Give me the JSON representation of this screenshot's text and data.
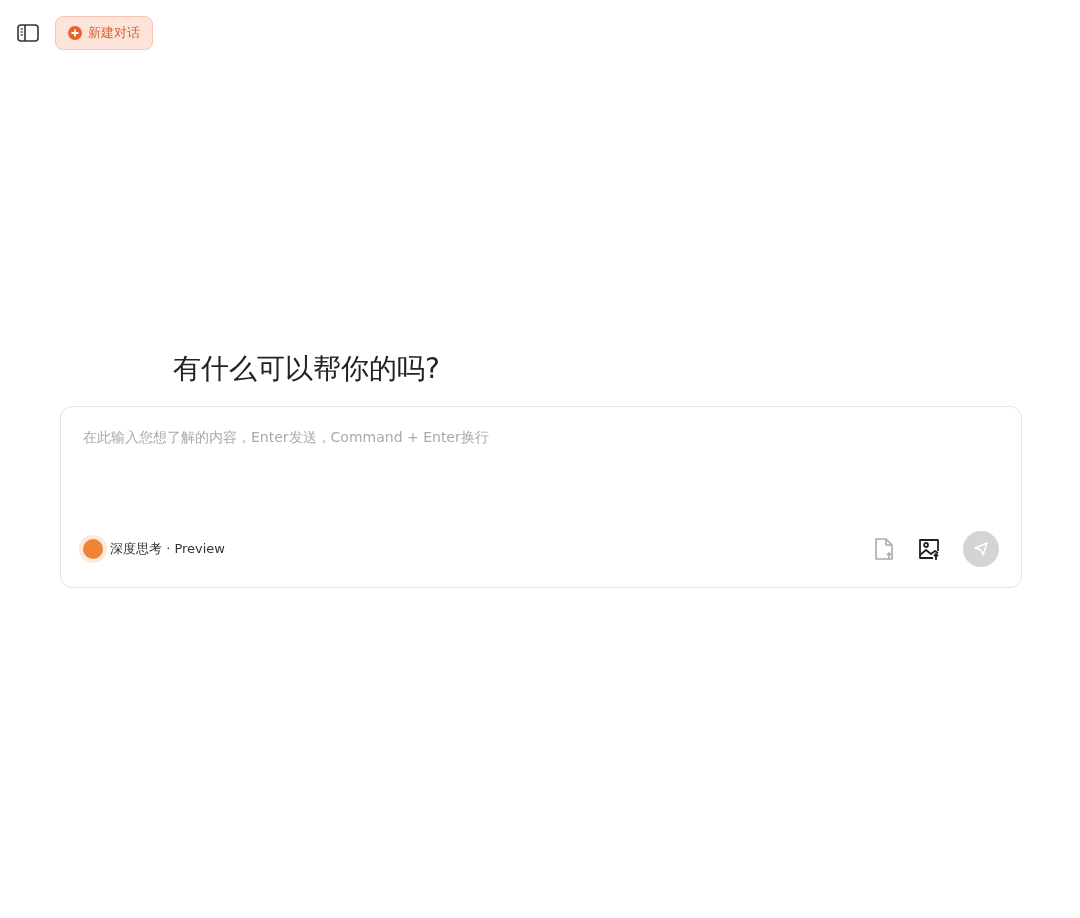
{
  "toolbar": {
    "new_chat_label": "新建对话"
  },
  "greeting": "有什么可以帮你的吗?",
  "composer": {
    "placeholder": "在此输入您想了解的内容，Enter发送，Command + Enter换行",
    "deep_think": {
      "label": "深度思考 · Preview",
      "on": true
    },
    "attach_file": {
      "disabled": true
    },
    "attach_image": {
      "disabled": false
    },
    "send": {
      "disabled": true
    }
  }
}
